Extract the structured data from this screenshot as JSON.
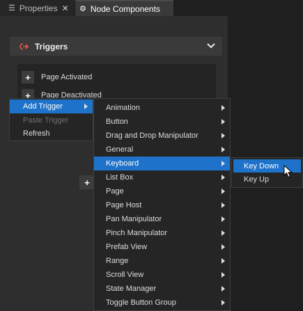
{
  "tabs": [
    {
      "label": "Properties",
      "icon": "list-icon"
    },
    {
      "label": "Node Components",
      "icon": "components-icon"
    }
  ],
  "triggers": {
    "title": "Triggers",
    "items": [
      {
        "label": "Page Activated"
      },
      {
        "label": "Page Deactivated"
      }
    ]
  },
  "context_menu": {
    "items": [
      {
        "label": "Add Trigger",
        "state": "highlighted"
      },
      {
        "label": "Paste Trigger",
        "state": "disabled"
      },
      {
        "label": "Refresh",
        "state": "normal"
      }
    ]
  },
  "submenu": {
    "items": [
      {
        "label": "Animation"
      },
      {
        "label": "Button"
      },
      {
        "label": "Drag and Drop Manipulator"
      },
      {
        "label": "General"
      },
      {
        "label": "Keyboard"
      },
      {
        "label": "List Box"
      },
      {
        "label": "Page"
      },
      {
        "label": "Page Host"
      },
      {
        "label": "Pan Manipulator"
      },
      {
        "label": "Pinch Manipulator"
      },
      {
        "label": "Prefab View"
      },
      {
        "label": "Range"
      },
      {
        "label": "Scroll View"
      },
      {
        "label": "State Manager"
      },
      {
        "label": "Toggle Button Group"
      }
    ],
    "highlighted": "Keyboard"
  },
  "keyboard_menu": {
    "items": [
      {
        "label": "Key Down"
      },
      {
        "label": "Key Up"
      }
    ],
    "highlighted": "Key Down"
  },
  "colors": {
    "highlight": "#1e72c9",
    "trigger_icon": "#e05a4f"
  }
}
